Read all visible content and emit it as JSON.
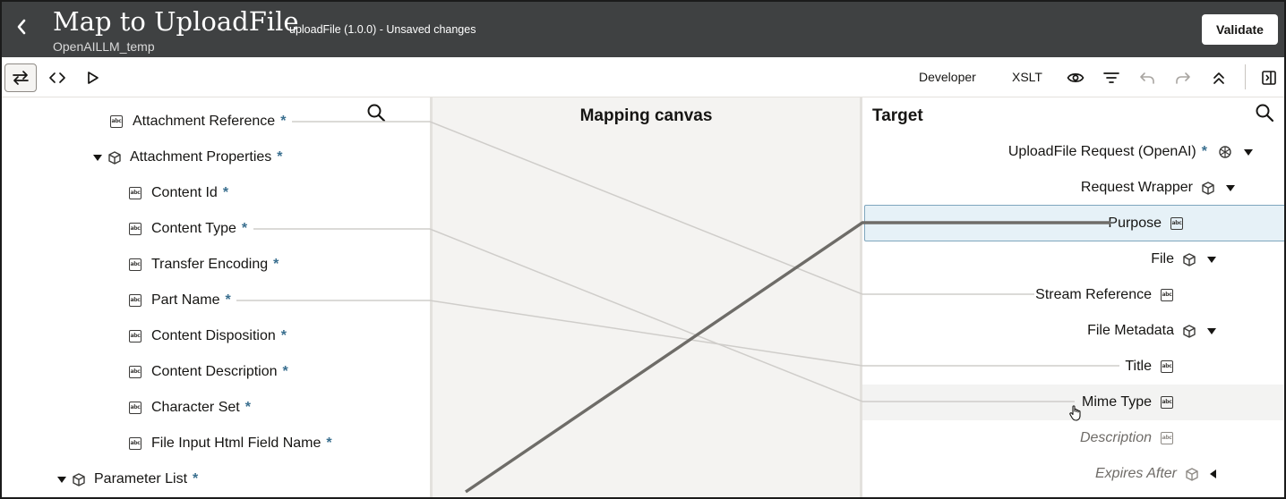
{
  "header": {
    "title": "Map to UploadFile",
    "subtitle": "OpenAILLM_temp",
    "status": "uploadFile (1.0.0) - Unsaved changes",
    "validate_label": "Validate",
    "back_icon": "chevron-left-icon"
  },
  "toolbar": {
    "developer_label": "Developer",
    "xslt_label": "XSLT",
    "icons": [
      "swap-icon",
      "code-icon",
      "play-icon",
      "eye-icon",
      "filter-icon",
      "undo-icon",
      "redo-icon",
      "collapse-all-icon",
      "panel-toggle-icon"
    ]
  },
  "source": {
    "items": [
      {
        "label": "Attachment Reference",
        "required": "*",
        "type": "text"
      },
      {
        "label": "Attachment Properties",
        "required": "*",
        "type": "object"
      },
      {
        "label": "Content Id",
        "required": "*",
        "type": "text"
      },
      {
        "label": "Content Type",
        "required": "*",
        "type": "text"
      },
      {
        "label": "Transfer Encoding",
        "required": "*",
        "type": "text"
      },
      {
        "label": "Part Name",
        "required": "*",
        "type": "text"
      },
      {
        "label": "Content Disposition",
        "required": "*",
        "type": "text"
      },
      {
        "label": "Content Description",
        "required": "*",
        "type": "text"
      },
      {
        "label": "Character Set",
        "required": "*",
        "type": "text"
      },
      {
        "label": "File Input Html Field Name",
        "required": "*",
        "type": "text"
      },
      {
        "label": "Parameter List",
        "required": "*",
        "type": "object"
      }
    ]
  },
  "canvas": {
    "title": "Mapping canvas"
  },
  "target": {
    "title": "Target",
    "items": [
      {
        "label": "UploadFile Request (OpenAI)",
        "required": "*",
        "type": "openai"
      },
      {
        "label": "Request Wrapper",
        "type": "object"
      },
      {
        "label": "Purpose",
        "type": "text"
      },
      {
        "label": "File",
        "type": "object"
      },
      {
        "label": "Stream Reference",
        "type": "text"
      },
      {
        "label": "File Metadata",
        "type": "object"
      },
      {
        "label": "Title",
        "type": "text"
      },
      {
        "label": "Mime Type",
        "type": "text"
      },
      {
        "label": "Description",
        "type": "text"
      },
      {
        "label": "Expires After",
        "type": "object"
      }
    ]
  },
  "colors": {
    "header_bg": "#3f4142",
    "required_star": "#3a6f8f",
    "selected_row": "#e6f1f7",
    "canvas_bg": "#f4f3f1"
  }
}
